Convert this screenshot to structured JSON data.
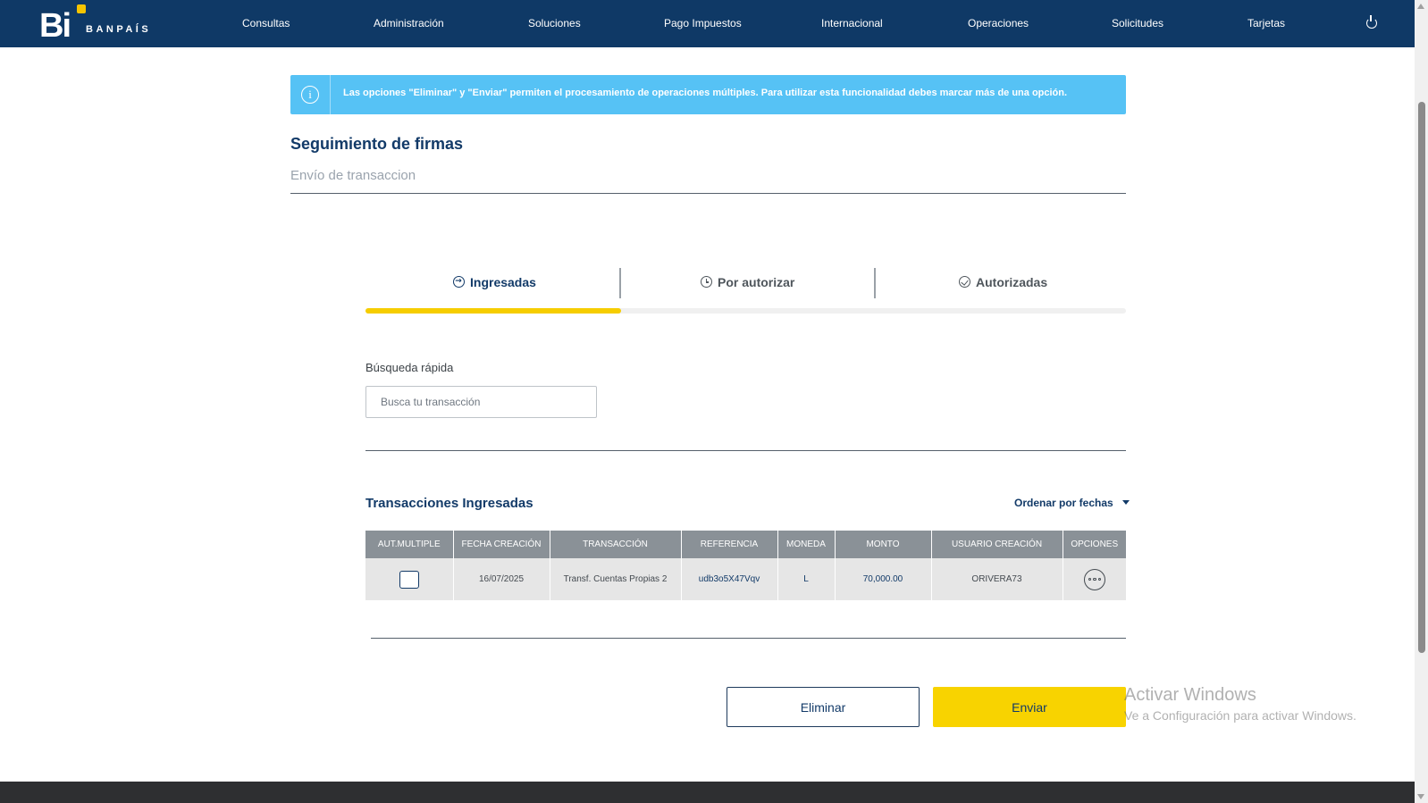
{
  "header": {
    "logo_mark": "Bi",
    "logo_text": "BANPAÍS",
    "nav": [
      "Consultas",
      "Administración",
      "Soluciones",
      "Pago Impuestos",
      "Internacional",
      "Operaciones",
      "Solicitudes",
      "Tarjetas"
    ],
    "power_icon": "power-icon"
  },
  "banner": {
    "icon": "info-icon",
    "message": "Las opciones \"Eliminar\" y \"Enviar\" permiten el procesamiento de operaciones múltiples. Para utilizar esta funcionalidad debes marcar más de una opción."
  },
  "page": {
    "title": "Seguimiento de firmas",
    "subtitle": "Envío de transaccion"
  },
  "tabs": [
    {
      "label": "Ingresadas",
      "icon": "arrow-circle-icon",
      "active": true
    },
    {
      "label": "Por autorizar",
      "icon": "clock-icon",
      "active": false
    },
    {
      "label": "Autorizadas",
      "icon": "check-circle-icon",
      "active": false
    }
  ],
  "search": {
    "label": "Búsqueda rápida",
    "placeholder": "Busca tu transacción",
    "value": ""
  },
  "transactions": {
    "title": "Transacciones Ingresadas",
    "sort_label": "Ordenar por fechas",
    "columns": [
      "AUT.MULTIPLE",
      "FECHA CREACIÓN",
      "TRANSACCIÓN",
      "REFERENCIA",
      "MONEDA",
      "MONTO",
      "USUARIO CREACIÓN",
      "OPCIONES"
    ],
    "rows": [
      {
        "checked": false,
        "fecha": "16/07/2025",
        "transaccion": "Transf. Cuentas Propias 2",
        "referencia": "udb3o5X47Vqv",
        "moneda": "L",
        "monto": "70,000.00",
        "usuario": "ORIVERA73"
      }
    ]
  },
  "actions": {
    "delete_label": "Eliminar",
    "send_label": "Enviar"
  },
  "watermark": {
    "line1": "Activar Windows",
    "line2": "Ve a Configuración para activar Windows."
  },
  "colors": {
    "navbar": "#0f3966",
    "accent_yellow": "#f8d300",
    "banner_blue": "#56c2f5",
    "primary_text": "#123a68"
  }
}
